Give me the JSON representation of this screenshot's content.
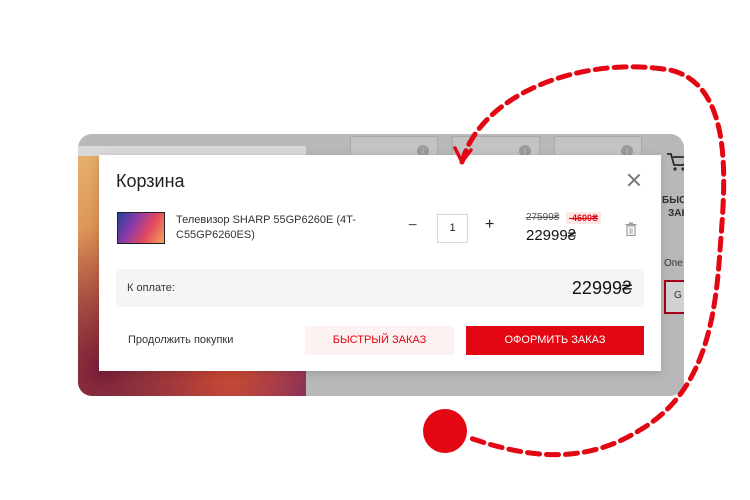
{
  "modal": {
    "title": "Корзина",
    "close_icon": "close-icon"
  },
  "cart_item": {
    "name": "Телевизор SHARP 55GP6260E (4T-C55GP6260ES)",
    "quantity": "1",
    "minus_label": "−",
    "plus_label": "+",
    "old_price": "27599₴",
    "discount": "-4600₴",
    "price": "22999₴",
    "delete_icon": "trash-icon"
  },
  "summary": {
    "label": "К оплате:",
    "total": "22999₴"
  },
  "actions": {
    "continue_label": "Продолжить покупки",
    "quick_order_label": "БЫСТРЫЙ ЗАКАЗ",
    "checkout_label": "ОФОРМИТЬ ЗАКАЗ"
  },
  "background": {
    "side_text_1": "БЫСТ",
    "side_text_2": "ЗАК",
    "side_text_3": "Опе",
    "side_text_4": "G"
  },
  "colors": {
    "accent": "#e30613",
    "annotation": "#e30613"
  }
}
